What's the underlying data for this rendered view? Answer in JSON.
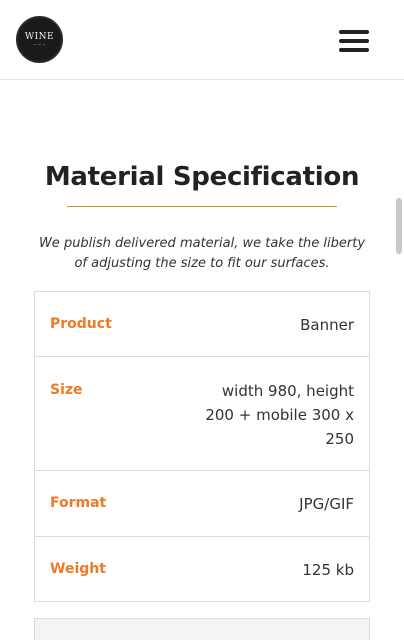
{
  "header": {
    "logo_text": "WINE",
    "logo_sub": "~ ~ ~"
  },
  "page": {
    "title": "Material Specification",
    "intro": "We publish delivered material, we take the liberty of adjusting the size to fit our surfaces."
  },
  "specs": [
    {
      "label": "Product",
      "value": "Banner"
    },
    {
      "label": "Size",
      "value": "width 980, height 200 + mobile 300 x 250"
    },
    {
      "label": "Format",
      "value": "JPG/GIF"
    },
    {
      "label": "Weight",
      "value": "125 kb"
    }
  ],
  "colors": {
    "accent": "#f07a24",
    "rule": "#c89a2e",
    "text": "#333333"
  },
  "icons": {
    "menu": "hamburger-icon",
    "logo": "wine-logo"
  }
}
